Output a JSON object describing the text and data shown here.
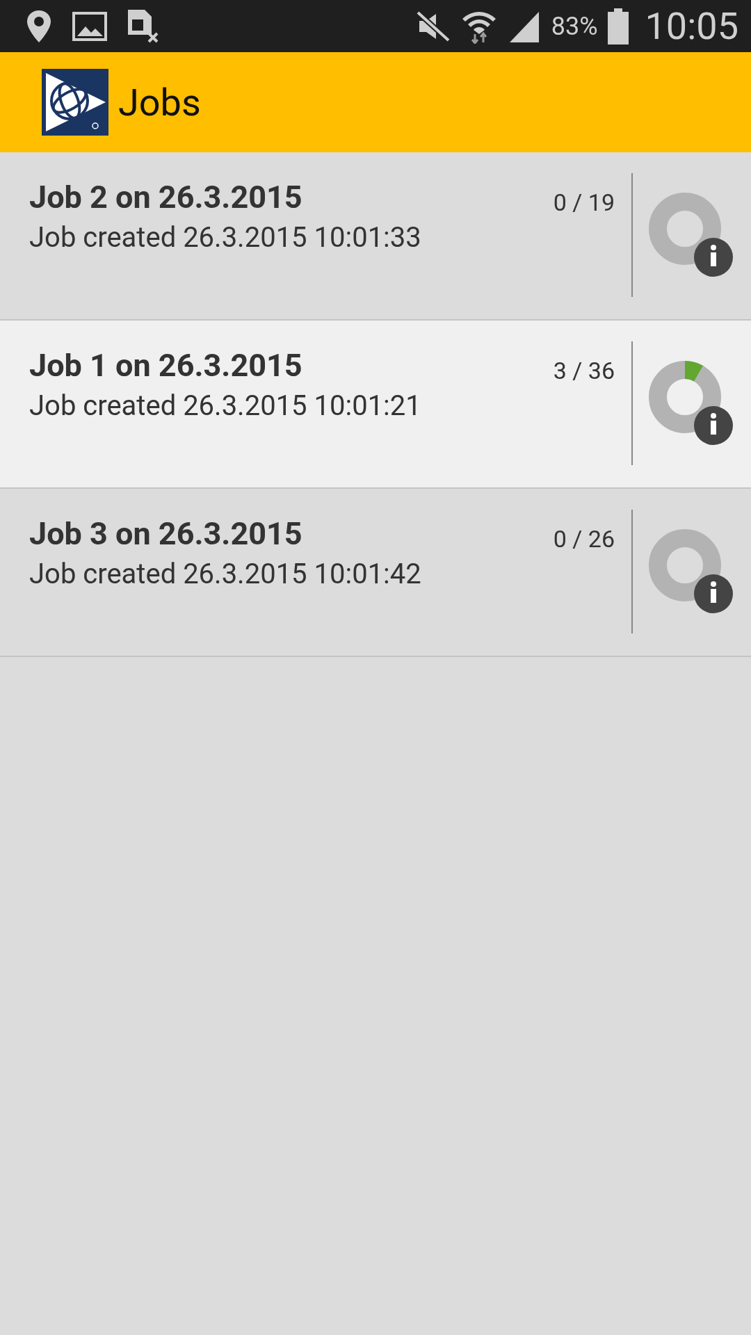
{
  "status_bar": {
    "battery": "83%",
    "time": "10:05"
  },
  "app_bar": {
    "title": "Jobs"
  },
  "jobs": [
    {
      "title": "Job 2 on 26.3.2015",
      "created": "Job created 26.3.2015 10:01:33",
      "count": "0 / 19",
      "level": 0,
      "selected": false
    },
    {
      "title": "Job 1 on 26.3.2015",
      "created": "Job created 26.3.2015 10:01:21",
      "count": "3 / 36",
      "level": 0.083,
      "selected": true
    },
    {
      "title": "Job 3 on 26.3.2015",
      "created": "Job created 26.3.2015 10:01:42",
      "count": "0 / 26",
      "level": 0,
      "selected": false
    }
  ]
}
